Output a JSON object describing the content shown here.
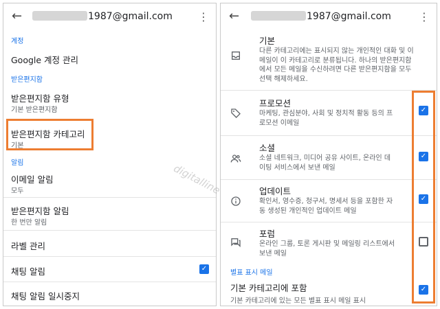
{
  "left": {
    "email": "1987@gmail.com",
    "sections": {
      "account": "계정",
      "inbox": "받은편지함",
      "notifications": "알림"
    },
    "items": {
      "manage_google": "Google 계정 관리",
      "inbox_type_title": "받은편지함 유형",
      "inbox_type_sub": "기본 받은편지함",
      "categories_title": "받은편지함 카테고리",
      "categories_sub": "기본",
      "email_notif_title": "이메일 알림",
      "email_notif_sub": "모두",
      "inbox_notif_title": "받은편지함 알림",
      "inbox_notif_sub": "한 번만 알림",
      "manage_labels": "라벨 관리",
      "chat_notif": "채팅 알림",
      "chat_pause": "채팅 알림 일시중지"
    },
    "chat_notif_checked": true
  },
  "right": {
    "email": "1987@gmail.com",
    "categories": [
      {
        "icon": "inbox-icon",
        "title": "기본",
        "desc": "다른 카테고리에는 표시되지 않는 개인적인 대화 및 이메일이 이 카테고리로 분류됩니다. 하나의 받은편지함에서 모든 메일을 수신하려면 다른 받은편지함을 모두 선택 해제하세요."
      },
      {
        "icon": "tag-icon",
        "title": "프로모션",
        "desc": "마케팅, 관심분야, 사회 및 정치적 활동 등의 프로모션 이메일",
        "checked": true
      },
      {
        "icon": "people-icon",
        "title": "소셜",
        "desc": "소셜 네트워크, 미디어 공유 사이트, 온라인 데이팅 서비스에서 보낸 메일",
        "checked": true
      },
      {
        "icon": "info-icon",
        "title": "업데이트",
        "desc": "확인서, 영수증, 청구서, 명세서 등을 포함한 자동 생성된 개인적인 업데이트 메일",
        "checked": true
      },
      {
        "icon": "forum-icon",
        "title": "포럼",
        "desc": "온라인 그룹, 토론 게시판 및 메일링 리스트에서 보낸 메일",
        "checked": false
      }
    ],
    "starred_section": "별표 표시 메일",
    "starred_title": "기본 카테고리에 포함",
    "starred_desc": "기본 카테고리에 있는 모든 별표 표시 메일 표시",
    "starred_checked": true
  },
  "watermark": "digitalline",
  "colors": {
    "accent": "#1a73e8",
    "highlight": "#ed7d31"
  }
}
